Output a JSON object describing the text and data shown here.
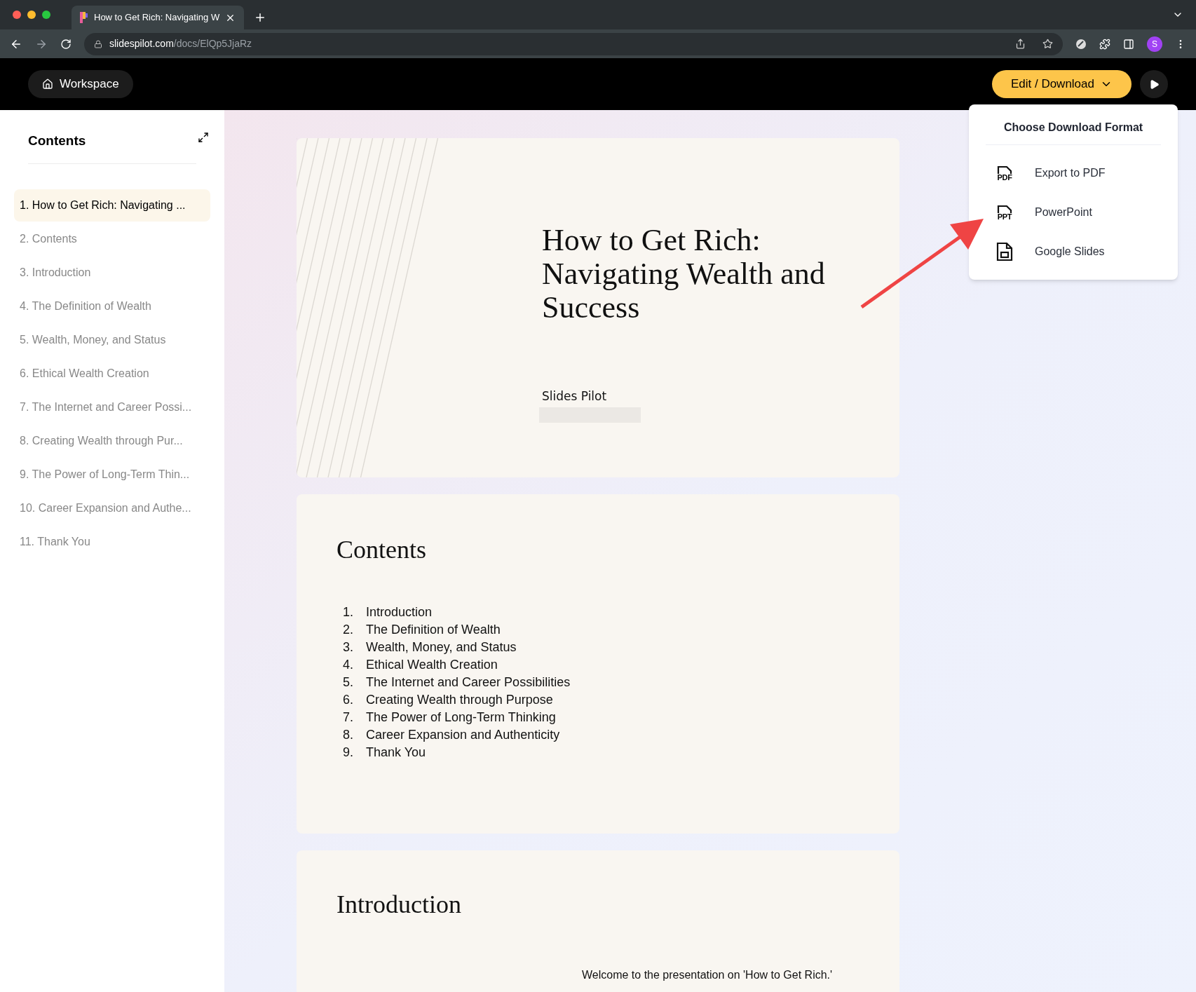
{
  "browser": {
    "tab_title": "How to Get Rich: Navigating W",
    "url_domain": "slidespilot.com",
    "url_path": "/docs/ElQp5JjaRz",
    "avatar_letter": "S"
  },
  "header": {
    "workspace": "Workspace",
    "edit_download": "Edit / Download"
  },
  "sidebar": {
    "heading": "Contents",
    "items": [
      {
        "label": "1. How to Get Rich: Navigating ...",
        "selected": true
      },
      {
        "label": "2. Contents",
        "selected": false
      },
      {
        "label": "3. Introduction",
        "selected": false
      },
      {
        "label": "4. The Definition of Wealth",
        "selected": false
      },
      {
        "label": "5. Wealth, Money, and Status",
        "selected": false
      },
      {
        "label": "6. Ethical Wealth Creation",
        "selected": false
      },
      {
        "label": "7. The Internet and Career Possi...",
        "selected": false
      },
      {
        "label": "8. Creating Wealth through Pur...",
        "selected": false
      },
      {
        "label": "9. The Power of Long-Term Thin...",
        "selected": false
      },
      {
        "label": "10. Career Expansion and Authe...",
        "selected": false
      },
      {
        "label": "11. Thank You",
        "selected": false
      }
    ]
  },
  "dropdown": {
    "title": "Choose Download Format",
    "options": [
      {
        "kind": "pdf",
        "icon_text": "PDF",
        "label": "Export to PDF"
      },
      {
        "kind": "ppt",
        "icon_text": "PPT",
        "label": "PowerPoint"
      },
      {
        "kind": "slides",
        "label": "Google Slides"
      }
    ]
  },
  "slides": [
    {
      "kind": "title",
      "title": "How to Get Rich: Navigating Wealth and Success",
      "author": "Slides Pilot"
    },
    {
      "kind": "list",
      "heading": "Contents",
      "items": [
        {
          "number": "1.",
          "text": "Introduction"
        },
        {
          "number": "2.",
          "text": "The Definition of Wealth"
        },
        {
          "number": "3.",
          "text": "Wealth, Money, and Status"
        },
        {
          "number": "4.",
          "text": "Ethical Wealth Creation"
        },
        {
          "number": "5.",
          "text": "The Internet and Career Possibilities"
        },
        {
          "number": "6.",
          "text": "Creating Wealth through Purpose"
        },
        {
          "number": "7.",
          "text": "The Power of Long-Term Thinking"
        },
        {
          "number": "8.",
          "text": "Career Expansion and Authenticity"
        },
        {
          "number": "9.",
          "text": "Thank You"
        }
      ]
    },
    {
      "kind": "intro",
      "heading": "Introduction",
      "body": "Welcome to the presentation on 'How to Get Rich.'"
    }
  ]
}
